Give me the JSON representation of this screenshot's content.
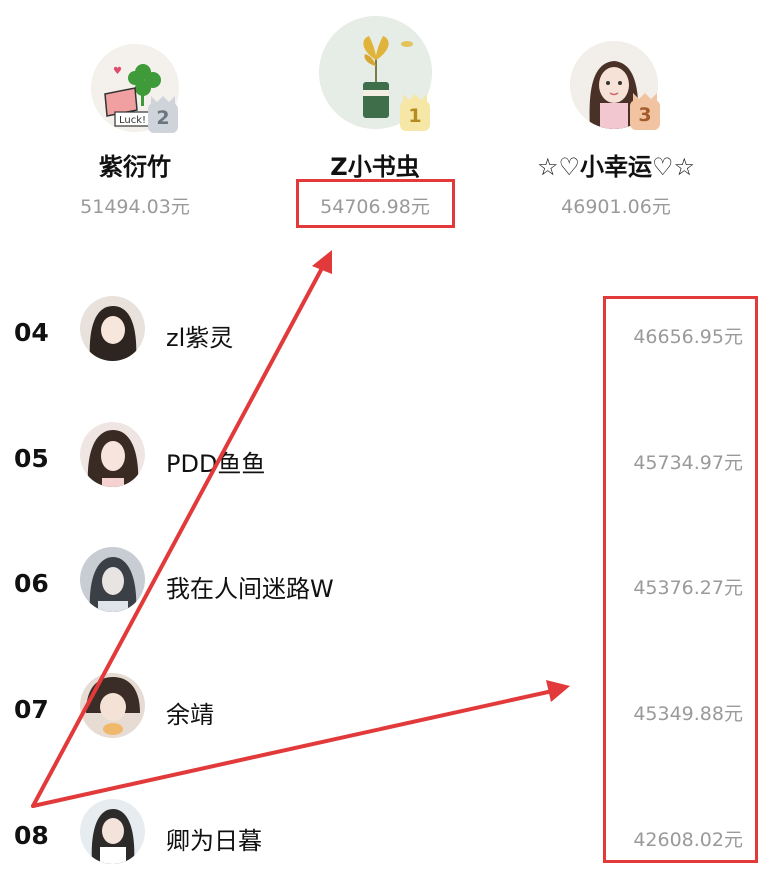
{
  "podium": [
    {
      "rank": "2",
      "name": "紫衍竹",
      "amount": "51494.03元"
    },
    {
      "rank": "1",
      "name": "Z小书虫",
      "amount": "54706.98元"
    },
    {
      "rank": "3",
      "name": "☆♡小幸运♡☆",
      "amount": "46901.06元"
    }
  ],
  "list": [
    {
      "rank": "04",
      "name": "zl紫灵",
      "amount": "46656.95元"
    },
    {
      "rank": "05",
      "name": "PDD鱼鱼",
      "amount": "45734.97元"
    },
    {
      "rank": "06",
      "name": "我在人间迷路W",
      "amount": "45376.27元"
    },
    {
      "rank": "07",
      "name": "余靖",
      "amount": "45349.88元"
    },
    {
      "rank": "08",
      "name": "卿为日暮",
      "amount": "42608.02元"
    }
  ],
  "colors": {
    "annotation": "#e23a3a",
    "amount_text": "#9a9a9a"
  }
}
